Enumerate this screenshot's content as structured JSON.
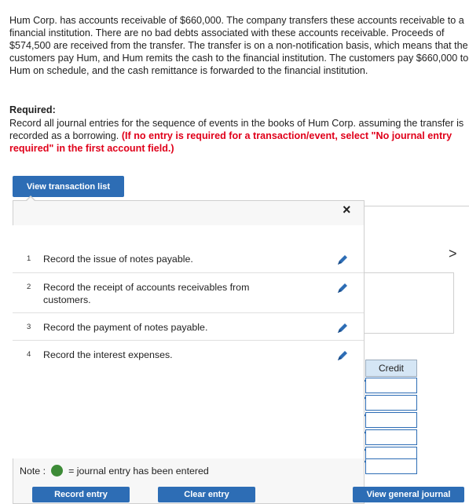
{
  "problem_text": "Hum Corp. has accounts receivable of $660,000. The company transfers these accounts receivable to a financial institution. There are no bad debts associated with these accounts receivable. Proceeds of $574,500 are received from the transfer. The transfer is on a non-notification basis, which means that the customers pay Hum, and Hum remits the cash to the financial institution. The customers pay $660,000 to Hum on schedule, and the cash remittance is forwarded to the financial institution.",
  "required_heading": "Required:",
  "required_text": "Record all journal entries for the sequence of events in the books of Hum Corp. assuming the transfer is recorded as a borrowing.",
  "required_instruction": "(If no entry is required for a transaction/event, select \"No journal entry required\" in the first account field.)",
  "view_transaction_list": "View transaction list",
  "close_icon": "×",
  "transactions": [
    {
      "num": "1",
      "text": "Record the issue of notes payable."
    },
    {
      "num": "2",
      "text": "Record the receipt of accounts receivables from customers."
    },
    {
      "num": "3",
      "text": "Record the payment of notes payable."
    },
    {
      "num": "4",
      "text": "Record the interest expenses."
    }
  ],
  "note_label": "Note :",
  "note_text": "= journal entry has been entered",
  "credit_header": "Credit",
  "next_chevron": ">",
  "buttons": {
    "record_entry": "Record entry",
    "clear_entry": "Clear entry",
    "view_general_journal": "View general journal"
  },
  "colors": {
    "button_blue": "#2d6db5",
    "instruction_red": "#e0001a",
    "entered_green": "#3d8b37"
  }
}
